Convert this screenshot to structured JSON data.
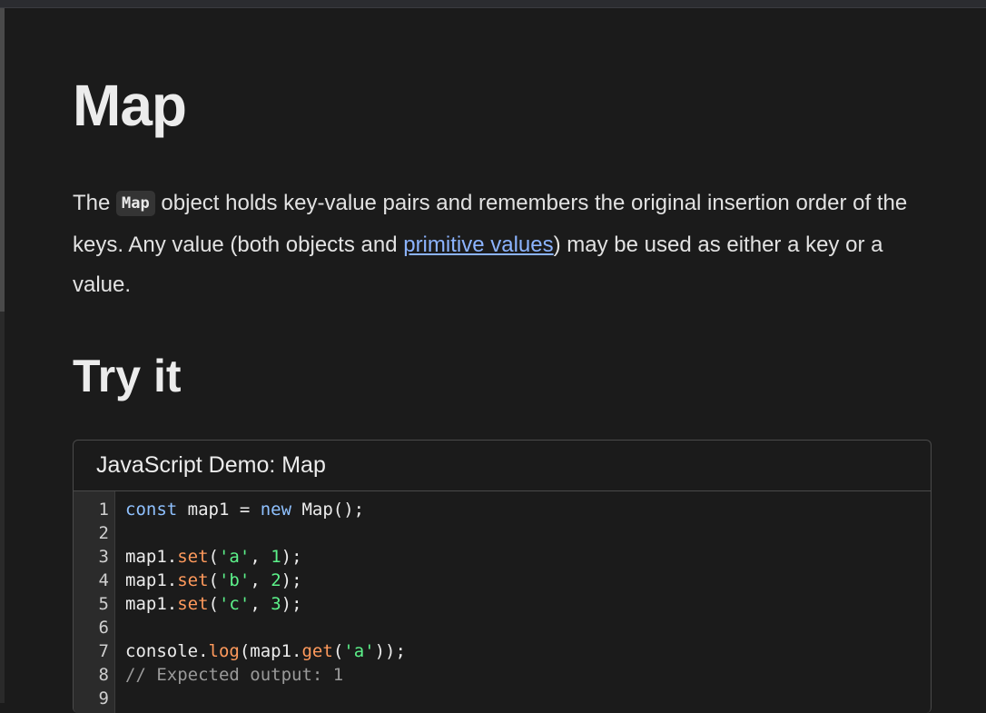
{
  "page": {
    "title": "Map",
    "intro": {
      "before_code": "The ",
      "code": "Map",
      "after_code": " object holds key-value pairs and remembers the original insertion order of the keys. Any value (both objects and ",
      "link": "primitive values",
      "after_link": ") may be used as either a key or a value."
    },
    "section_heading": "Try it"
  },
  "demo": {
    "header": "JavaScript Demo: Map",
    "line_numbers": [
      "1",
      "2",
      "3",
      "4",
      "5",
      "6",
      "7",
      "8",
      "9"
    ],
    "lines": [
      [
        {
          "t": "const",
          "c": "kw"
        },
        {
          "t": " map1 = ",
          "c": ""
        },
        {
          "t": "new",
          "c": "kw"
        },
        {
          "t": " Map();",
          "c": ""
        }
      ],
      [],
      [
        {
          "t": "map1.",
          "c": ""
        },
        {
          "t": "set",
          "c": "fn"
        },
        {
          "t": "(",
          "c": ""
        },
        {
          "t": "'a'",
          "c": "str"
        },
        {
          "t": ", ",
          "c": ""
        },
        {
          "t": "1",
          "c": "num"
        },
        {
          "t": ");",
          "c": ""
        }
      ],
      [
        {
          "t": "map1.",
          "c": ""
        },
        {
          "t": "set",
          "c": "fn"
        },
        {
          "t": "(",
          "c": ""
        },
        {
          "t": "'b'",
          "c": "str"
        },
        {
          "t": ", ",
          "c": ""
        },
        {
          "t": "2",
          "c": "num"
        },
        {
          "t": ");",
          "c": ""
        }
      ],
      [
        {
          "t": "map1.",
          "c": ""
        },
        {
          "t": "set",
          "c": "fn"
        },
        {
          "t": "(",
          "c": ""
        },
        {
          "t": "'c'",
          "c": "str"
        },
        {
          "t": ", ",
          "c": ""
        },
        {
          "t": "3",
          "c": "num"
        },
        {
          "t": ");",
          "c": ""
        }
      ],
      [],
      [
        {
          "t": "console.",
          "c": ""
        },
        {
          "t": "log",
          "c": "fn"
        },
        {
          "t": "(map1.",
          "c": ""
        },
        {
          "t": "get",
          "c": "fn"
        },
        {
          "t": "(",
          "c": ""
        },
        {
          "t": "'a'",
          "c": "str"
        },
        {
          "t": "));",
          "c": ""
        }
      ],
      [
        {
          "t": "// Expected output: 1",
          "c": "cmt"
        }
      ],
      []
    ]
  },
  "colors": {
    "background": "#1b1b1b",
    "link": "#8cb4ff",
    "keyword": "#8fc1ff",
    "function": "#ff9a5c",
    "string": "#5cf28a",
    "comment": "#9a9a9a"
  }
}
